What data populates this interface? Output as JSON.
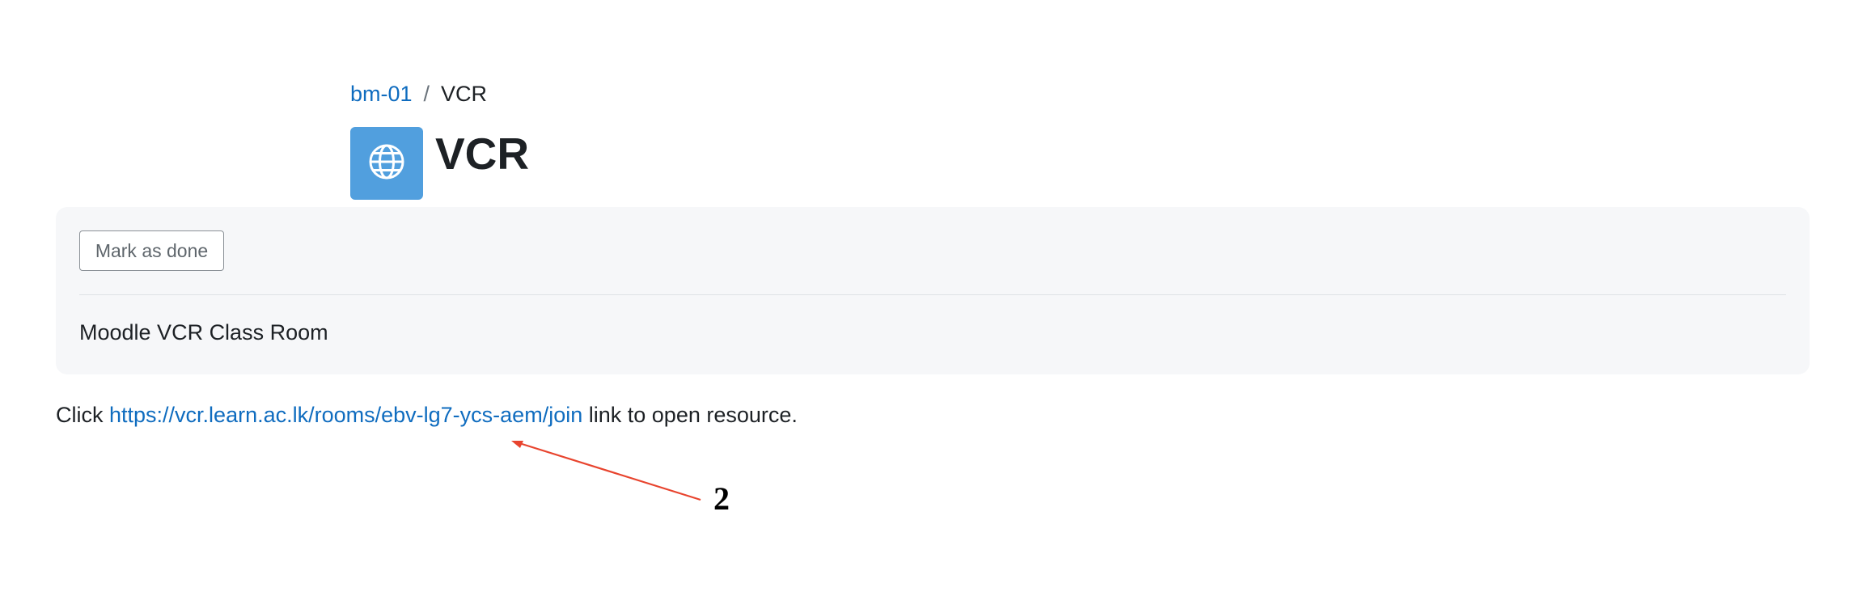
{
  "breadcrumb": {
    "course": "bm-01",
    "separator": "/",
    "current": "VCR"
  },
  "header": {
    "icon": "globe-icon",
    "title": "VCR",
    "icon_bg": "#519fde"
  },
  "completion": {
    "mark_done_label": "Mark as done"
  },
  "activity": {
    "description": "Moodle VCR Class Room"
  },
  "url_resource": {
    "prefix": "Click",
    "link": "https://vcr.learn.ac.lk/rooms/ebv-lg7-ycs-aem/join",
    "suffix": "link to open resource."
  },
  "annotation": {
    "label": "2",
    "color": "#e8442e"
  },
  "colors": {
    "link": "#0f6cbf",
    "text": "#1d2125",
    "panel_bg": "#f6f7f9"
  }
}
